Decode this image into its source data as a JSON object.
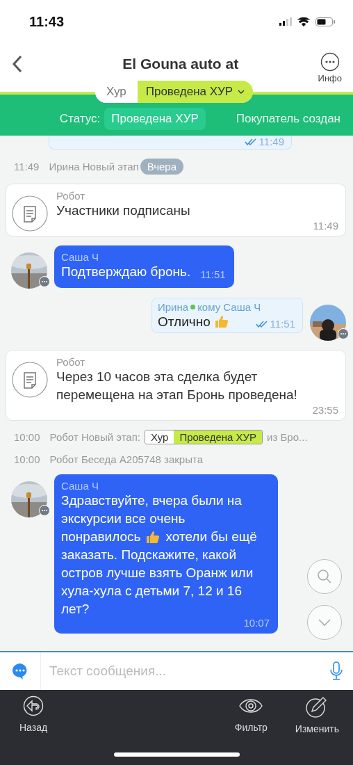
{
  "status_bar": {
    "time": "11:43"
  },
  "header": {
    "title": "El Gouna auto at",
    "info_label": "Инфо"
  },
  "stage_selector": {
    "pipeline": "Хур",
    "stage": "Проведена ХУР"
  },
  "status_row": {
    "label": "Статус:",
    "status": "Проведена ХУР",
    "buyer": "Покупатель создан"
  },
  "messages": [
    {
      "kind": "outgoing_cut",
      "time": "11:49",
      "read": true
    },
    {
      "kind": "event",
      "time": "11:49",
      "text": "Ирина Новый этап",
      "date_badge": "Вчера"
    },
    {
      "kind": "robot",
      "author": "Робот",
      "text": "Участники подписаны",
      "time": "11:49"
    },
    {
      "kind": "incoming",
      "author": "Саша Ч",
      "text": "Подтверждаю бронь.",
      "time": "11:51"
    },
    {
      "kind": "outgoing",
      "author": "Ирина",
      "online": true,
      "recipient": "кому Саша Ч",
      "text": "Отлично",
      "thumb": true,
      "time": "11:51",
      "read": true
    },
    {
      "kind": "robot",
      "author": "Робот",
      "text": "Через 10 часов эта сделка будет перемещена на этап Бронь проведена!",
      "time": "23:55"
    },
    {
      "kind": "stage_event",
      "time": "10:00",
      "text": "Робот Новый этап:",
      "pipeline": "Хур",
      "stage": "Проведена ХУР",
      "tail": "из Бро..."
    },
    {
      "kind": "event",
      "time": "10:00",
      "text": "Робот Беседа А205748 закрыта"
    },
    {
      "kind": "incoming",
      "author": "Саша Ч",
      "text": "Здравствуйте, вчера были на экскурсии все очень",
      "thumb": true,
      "thumb_before": "понравилось",
      "thumb_after": "хотели бы ещё",
      "text_after": "заказать. Подскажите, какой остров лучше взять Оранж или хула-хула с детьми 7, 12 и 16 лет?",
      "time": "10:07"
    }
  ],
  "composer": {
    "placeholder": "Текст сообщения..."
  },
  "toolbar": [
    {
      "kind": "back",
      "label": "Назад"
    },
    {
      "kind": "filter",
      "label": "Фильтр"
    },
    {
      "kind": "edit",
      "label": "Изменить"
    }
  ]
}
